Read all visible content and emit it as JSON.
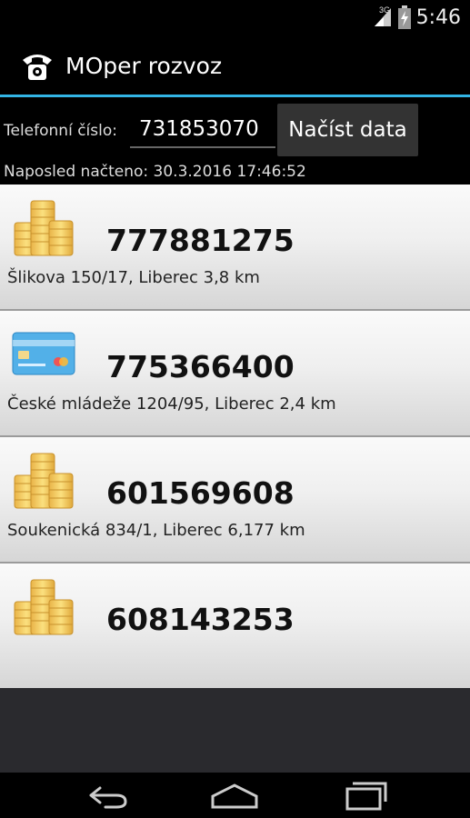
{
  "status": {
    "network": "3G",
    "time": "5:46"
  },
  "app": {
    "title": "MOper rozvoz",
    "icon": "phone-icon"
  },
  "controls": {
    "phone_label": "Telefonní číslo:",
    "phone_value": "731853070",
    "load_button": "Načíst data",
    "last_loaded": "Naposled načteno: 30.3.2016 17:46:52"
  },
  "orders": [
    {
      "payment_icon": "coins-icon",
      "phone": "777881275",
      "address": "Šlikova 150/17, Liberec 3,8 km"
    },
    {
      "payment_icon": "credit-card-icon",
      "phone": "775366400",
      "address": "České mládeže 1204/95, Liberec 2,4 km"
    },
    {
      "payment_icon": "coins-icon",
      "phone": "601569608",
      "address": "Soukenická 834/1, Liberec 6,177 km"
    },
    {
      "payment_icon": "coins-icon",
      "phone": "608143253",
      "address": ""
    }
  ],
  "colors": {
    "accent": "#33b5e5",
    "coin": "#f0c15a",
    "card": "#4aa3df"
  }
}
